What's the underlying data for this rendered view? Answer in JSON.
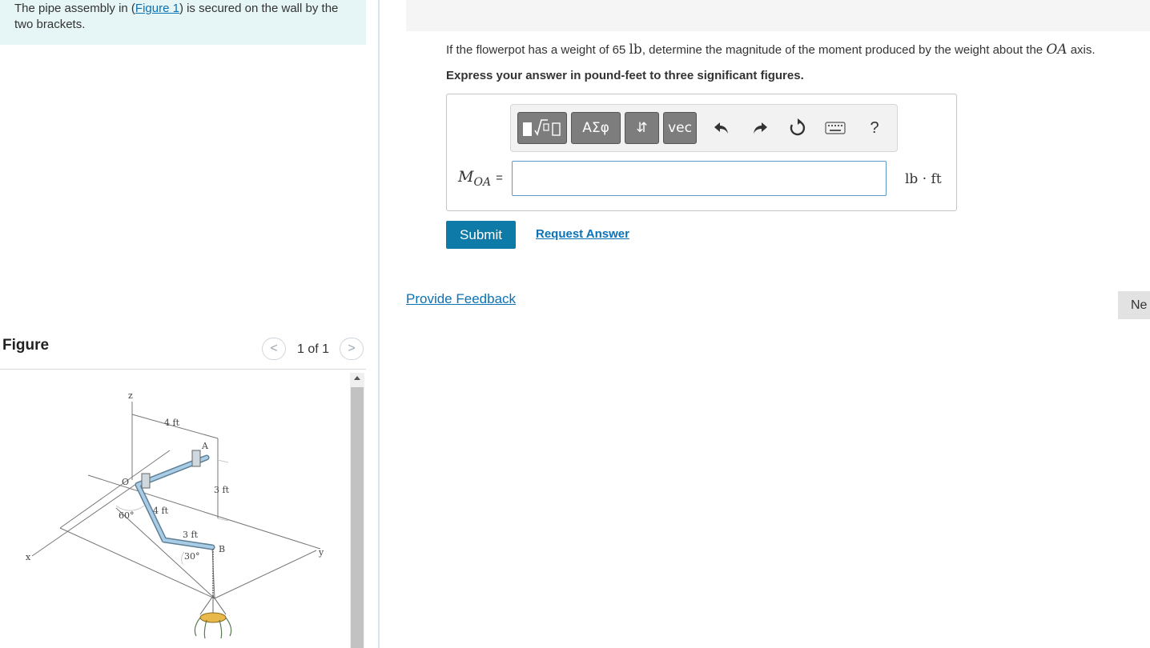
{
  "intro": {
    "text_before": "The pipe assembly in (",
    "figure_link": "Figure 1",
    "text_after": ") is secured on the wall by the two brackets."
  },
  "question": {
    "prefix": "If the flowerpot has a weight of 65 ",
    "weight_unit": "lb",
    "middle": ", determine the magnitude of the moment produced by the weight about the ",
    "axis": "OA",
    "suffix": " axis.",
    "instruction": "Express your answer in pound-feet to three significant figures."
  },
  "toolbar": {
    "templates_icon": "templates-icon",
    "greek_label": "ΑΣφ",
    "arrows_label": "⇵",
    "vec_label": "vec",
    "help_label": "?"
  },
  "answer": {
    "var_main": "M",
    "var_sub": "OA",
    "equals": "=",
    "value": "",
    "units": "lb · ft"
  },
  "buttons": {
    "submit": "Submit",
    "request_answer": "Request Answer",
    "provide_feedback": "Provide Feedback",
    "next": "Ne"
  },
  "figure_panel": {
    "title": "Figure",
    "counter": "1 of 1",
    "prev": "<",
    "next": ">"
  },
  "figure_labels": {
    "z": "z",
    "x": "x",
    "y": "y",
    "o": "O",
    "a": "A",
    "b": "B",
    "dim_4ft_top": "4 ft",
    "dim_4ft_pipe": "4 ft",
    "dim_3ft_vert": "3 ft",
    "dim_3ft_pipe": "3 ft",
    "angle_60": "60°",
    "angle_30": "30°"
  },
  "colors": {
    "accent": "#0e7aa8",
    "link": "#0b72b5",
    "intro_bg": "#e6f5f5",
    "pipe": "#8fb8d6"
  }
}
